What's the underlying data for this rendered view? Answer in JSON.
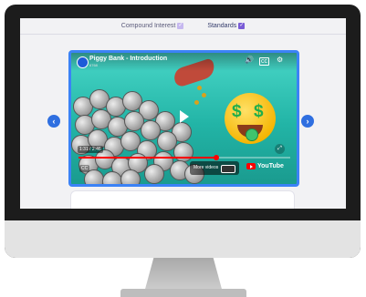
{
  "tabs": [
    {
      "label": "Compound Interest",
      "checked": false
    },
    {
      "label": "Standards",
      "checked": true
    }
  ],
  "video": {
    "title": "Piggy Bank - Introduction",
    "subtitle": "6768",
    "timecode": "1:31 / 2:46",
    "progress_fraction": 0.65,
    "cc_label": "CC",
    "more_videos_label": "More videos",
    "youtube_label": "YouTube"
  },
  "nav": {
    "prev_symbol": "‹",
    "next_symbol": "›"
  },
  "colors": {
    "accent": "#3b82f6",
    "checkbox": "#7a5cd6",
    "progress": "#ff0000"
  }
}
